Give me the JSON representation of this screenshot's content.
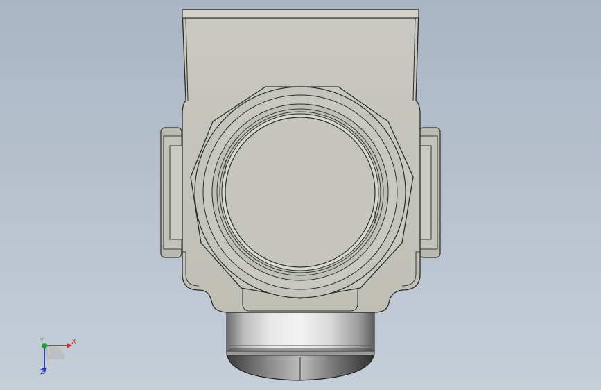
{
  "view": {
    "title": "",
    "background_color": "#b3bdca"
  },
  "model": {
    "part_name": "",
    "body_color": "#c4c4bc",
    "edge_color": "#2b2b2b",
    "chrome_color": "#cfcfcf"
  },
  "triad": {
    "x_label": "X",
    "y_label": "Y",
    "z_label": "Z",
    "x_color": "#d42a2a",
    "y_color": "#2a9a2a",
    "z_color": "#2f3fb0"
  }
}
